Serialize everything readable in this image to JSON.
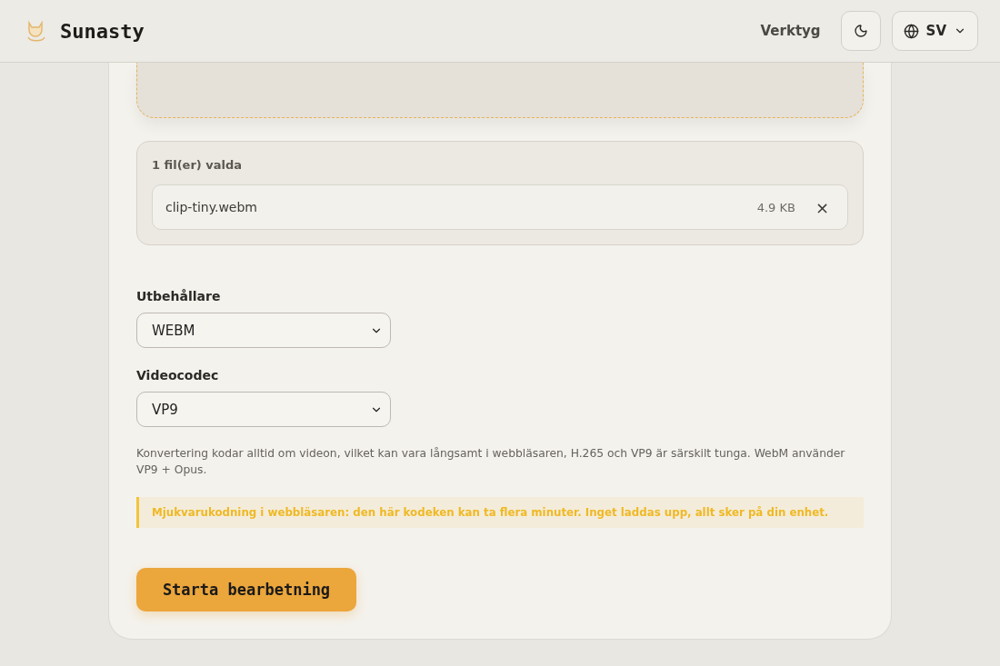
{
  "header": {
    "brand": "Sunasty",
    "nav_link": "Verktyg",
    "language": "SV"
  },
  "files": {
    "count_label": "1 fil(er) valda",
    "items": [
      {
        "name": "clip-tiny.webm",
        "size": "4.9 KB",
        "remove": "×"
      }
    ]
  },
  "fields": [
    {
      "label": "Utbehållare",
      "value": "WEBM"
    },
    {
      "label": "Videocodec",
      "value": "VP9"
    }
  ],
  "description": "Konvertering kodar alltid om videon, vilket kan vara långsamt i webbläsaren, H.265 och VP9 är särskilt tunga. WebM använder VP9 + Opus.",
  "warning": "Mjukvarukodning i webbläsaren: den här kodeken kan ta flera minuter. Inget laddas upp, allt sker på din enhet.",
  "submit": "Starta bearbetning"
}
